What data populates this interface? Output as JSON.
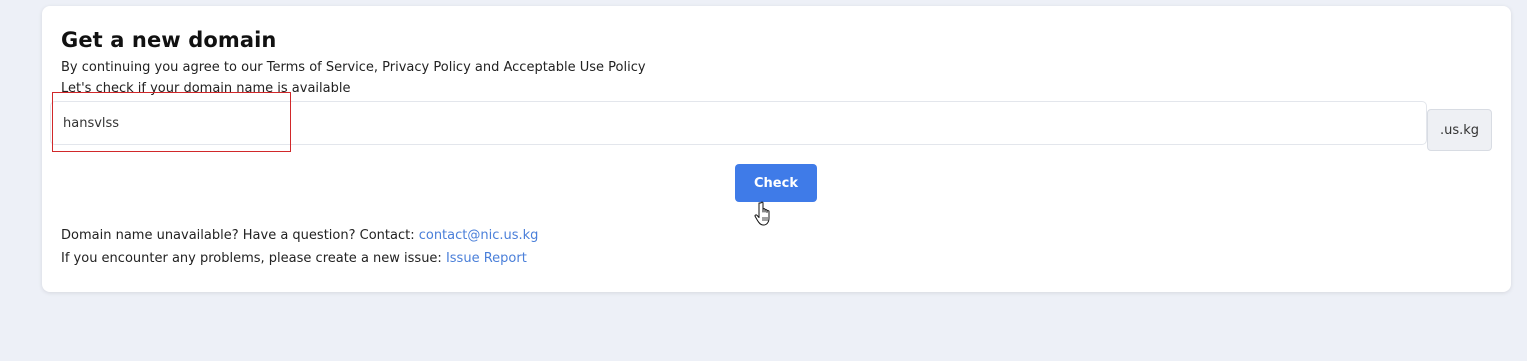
{
  "card": {
    "title": "Get a new domain",
    "terms_text": "By continuing you agree to our Terms of Service, Privacy Policy and Acceptable Use Policy",
    "check_availability_text": "Let's check if your domain name is available"
  },
  "domain_input": {
    "value": "hansvlss",
    "suffix": ".us.kg"
  },
  "check_button": {
    "label": "Check"
  },
  "contact": {
    "text": "Domain name unavailable? Have a question? Contact: ",
    "email": "contact@nic.us.kg"
  },
  "issue": {
    "text": "If you encounter any problems, please create a new issue: ",
    "link_label": "Issue Report"
  },
  "colors": {
    "background": "#edf0f7",
    "card": "#ffffff",
    "button": "#3f7be8",
    "link": "#4a7fd9",
    "highlight": "#d1282a"
  },
  "icons": {
    "cursor": "hand-pointer-icon"
  }
}
